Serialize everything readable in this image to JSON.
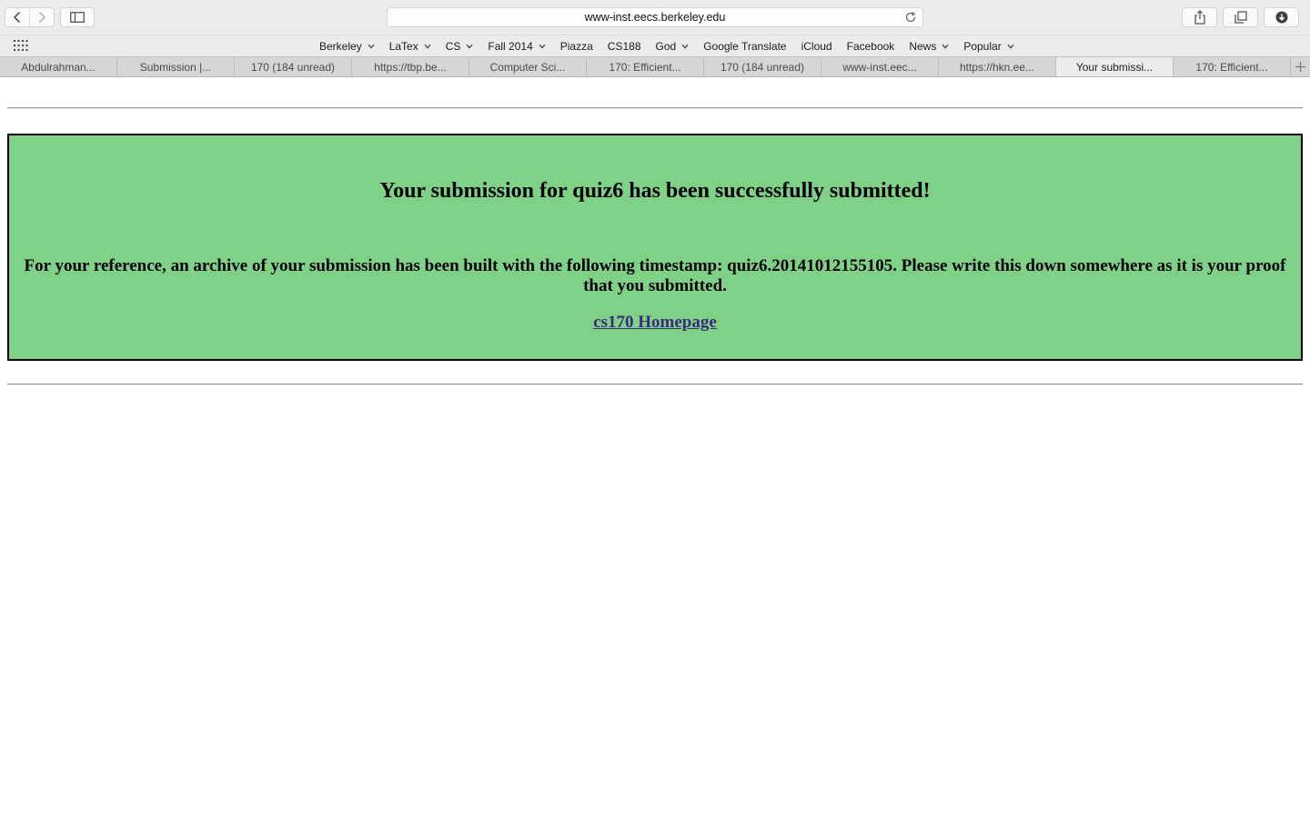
{
  "browser": {
    "address": "www-inst.eecs.berkeley.edu",
    "favorites": [
      {
        "label": "Berkeley",
        "has_menu": true
      },
      {
        "label": "LaTex",
        "has_menu": true
      },
      {
        "label": "CS",
        "has_menu": true
      },
      {
        "label": "Fall 2014",
        "has_menu": true
      },
      {
        "label": "Piazza",
        "has_menu": false
      },
      {
        "label": "CS188",
        "has_menu": false
      },
      {
        "label": "God",
        "has_menu": true
      },
      {
        "label": "Google Translate",
        "has_menu": false
      },
      {
        "label": "iCloud",
        "has_menu": false
      },
      {
        "label": "Facebook",
        "has_menu": false
      },
      {
        "label": "News",
        "has_menu": true
      },
      {
        "label": "Popular",
        "has_menu": true
      }
    ],
    "tabs": [
      {
        "label": "Abdulrahman..."
      },
      {
        "label": "Submission |..."
      },
      {
        "label": "170 (184 unread)"
      },
      {
        "label": "https://tbp.be..."
      },
      {
        "label": "Computer Sci..."
      },
      {
        "label": "170: Efficient..."
      },
      {
        "label": "170 (184 unread)"
      },
      {
        "label": "www-inst.eec..."
      },
      {
        "label": "https://hkn.ee..."
      },
      {
        "label": "Your submissi..."
      },
      {
        "label": "170: Efficient..."
      }
    ],
    "active_tab_index": 9
  },
  "page": {
    "title": "Your submission for quiz6 has been successfully submitted!",
    "message": "For your reference, an archive of your submission has been built with the following timestamp: quiz6.20141012155105. Please write this down somewhere as it is your proof that you submitted.",
    "link_label": "cs170 Homepage",
    "panel_color": "#7fd188"
  }
}
